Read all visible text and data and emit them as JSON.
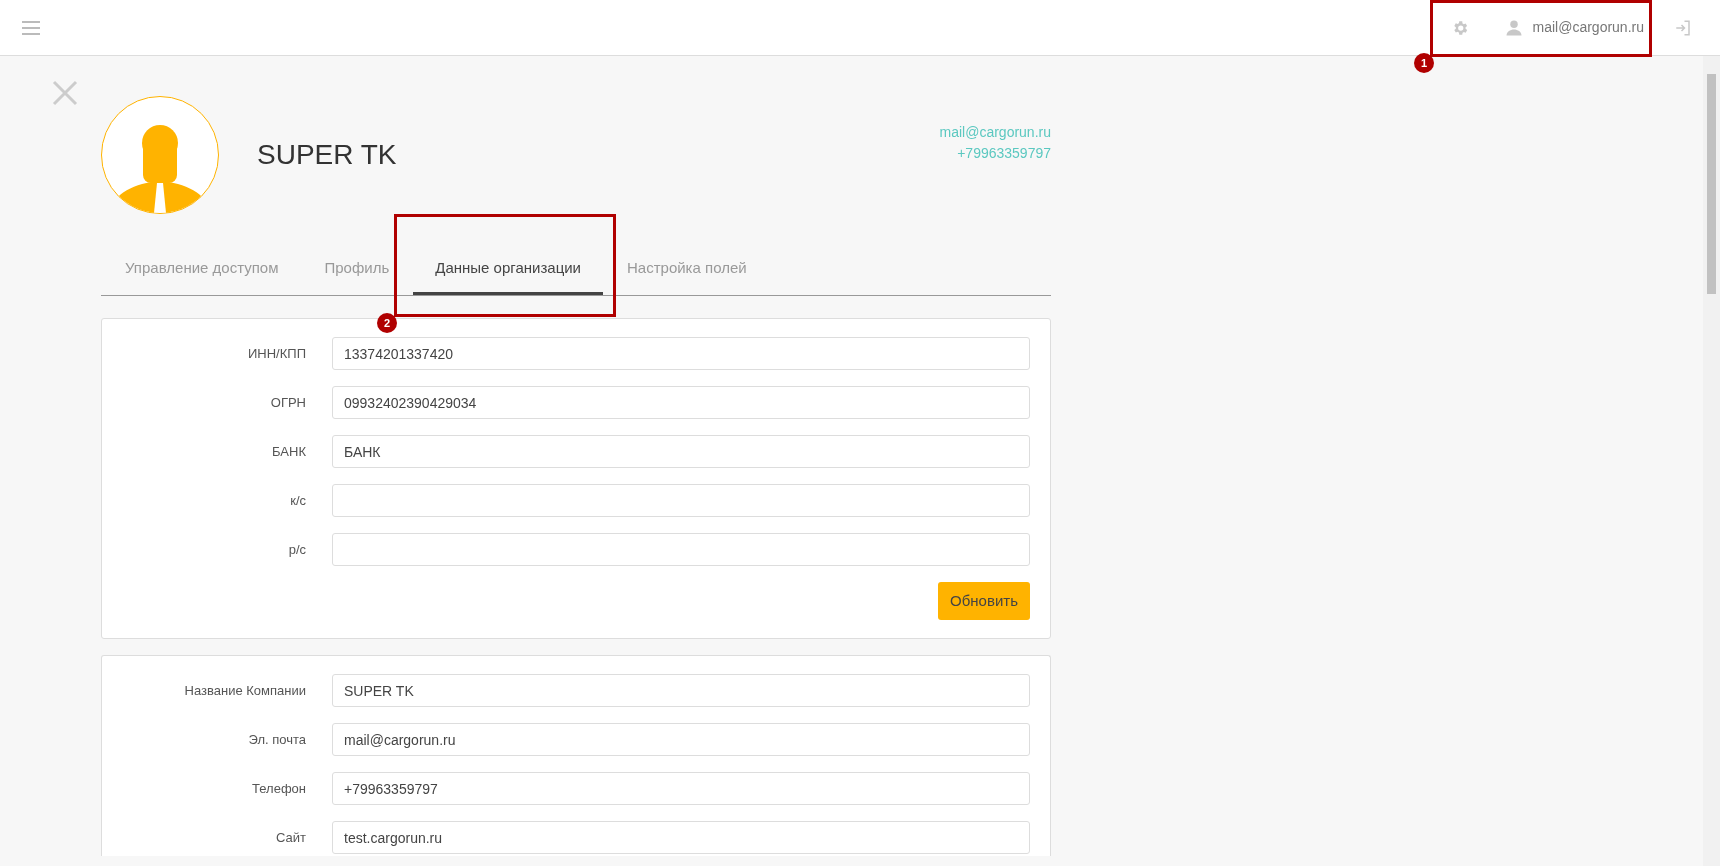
{
  "top_bar": {
    "user": "mail@cargorun.ru"
  },
  "profile": {
    "name": "SUPER TK",
    "email": "mail@cargorun.ru",
    "phone": "+79963359797"
  },
  "tabs": [
    {
      "label": "Управление доступом",
      "selected": false
    },
    {
      "label": "Профиль",
      "selected": false
    },
    {
      "label": "Данные организации",
      "selected": true
    },
    {
      "label": "Настройка полей",
      "selected": false
    }
  ],
  "bank_form": {
    "fields": [
      {
        "label": "ИНН/КПП",
        "value": "13374201337420"
      },
      {
        "label": "ОГРН",
        "value": "09932402390429034"
      },
      {
        "label": "БАНК",
        "value": "БАНК"
      },
      {
        "label": "к/с"
      },
      {
        "label": "р/с"
      }
    ],
    "button": "Обновить"
  },
  "company_form": {
    "fields": [
      {
        "label": "Название Компании",
        "value": "SUPER TK"
      },
      {
        "label": "Эл. почта",
        "value": "mail@cargorun.ru"
      },
      {
        "label": "Телефон",
        "value": "+79963359797"
      },
      {
        "label": "Сайт",
        "value": "test.cargorun.ru"
      }
    ]
  },
  "annotations": [
    {
      "number": "1",
      "kind": "user"
    },
    {
      "number": "2",
      "kind": "tab"
    }
  ]
}
